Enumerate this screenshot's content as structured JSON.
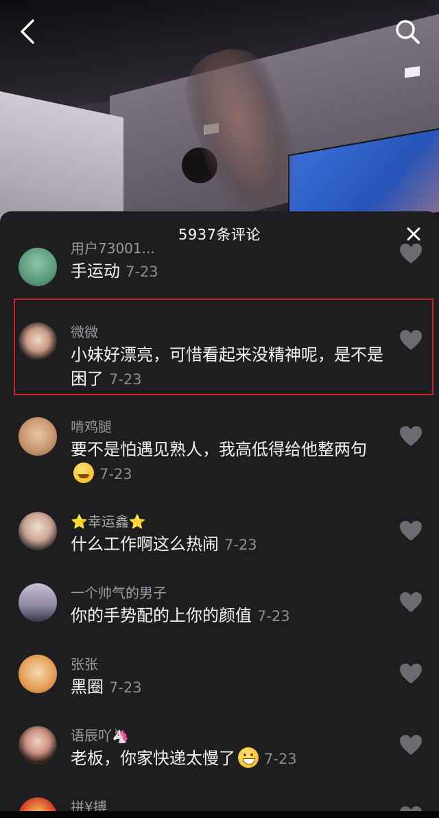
{
  "panel": {
    "title": "5937条评论"
  },
  "comments": [
    {
      "username": "用户73001...",
      "text": "手运动",
      "time": "7-23"
    },
    {
      "username": "微微",
      "text": "小妹好漂亮，可惜看起来没精神呢，是不是困了",
      "time": "7-23"
    },
    {
      "username": "啃鸡腿",
      "text": "要不是怕遇见熟人，我高低得给他整两句",
      "time": "7-23"
    },
    {
      "username": "⭐幸运鑫⭐",
      "text": "什么工作啊这么热闹",
      "time": "7-23"
    },
    {
      "username": "一个帅气的男子",
      "text": "你的手势配的上你的颜值",
      "time": "7-23"
    },
    {
      "username": "张张",
      "text": "黑圈",
      "time": "7-23"
    },
    {
      "username": "语辰吖🦄",
      "text": "老板，你家快递太慢了",
      "time": "7-23"
    },
    {
      "username": "拼¥搏",
      "text": "",
      "time": ""
    }
  ],
  "icons": {
    "back": "chevron-left-icon",
    "search": "search-icon",
    "close": "close-icon",
    "like": "heart-icon"
  },
  "colors": {
    "panel_bg": "#1e1e20",
    "highlight": "#c8262a"
  }
}
